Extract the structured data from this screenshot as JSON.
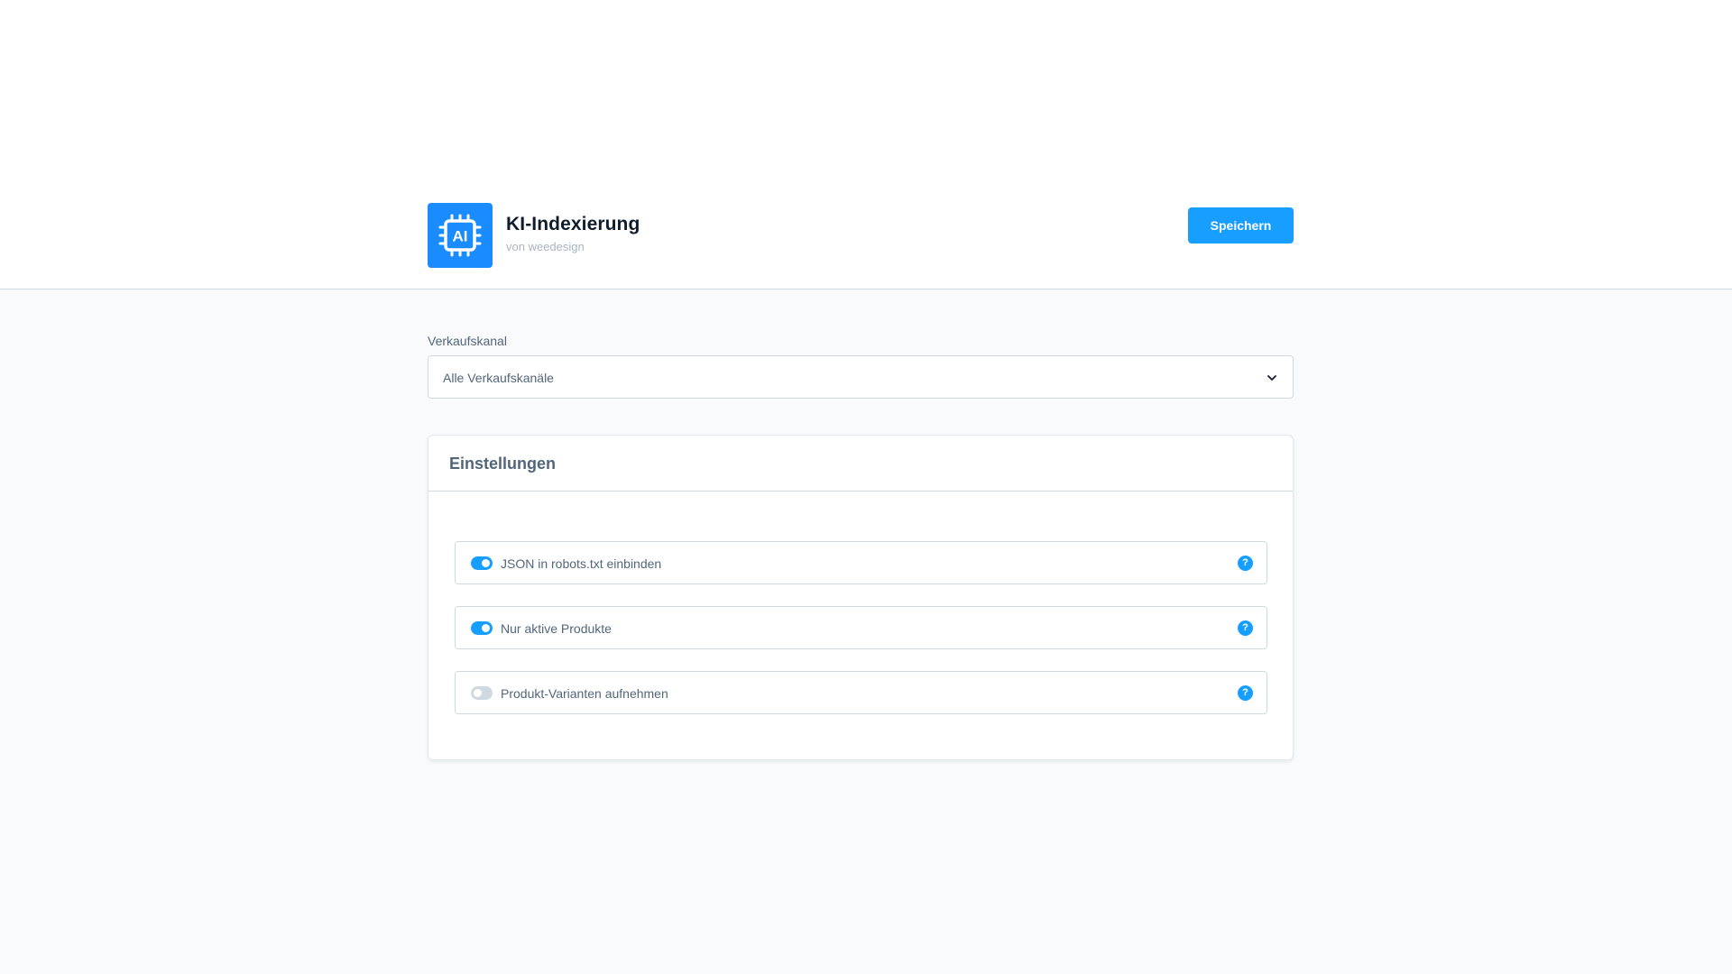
{
  "app": {
    "title": "KI-Indexierung",
    "subtitle": "von weedesign",
    "logo_icon": "ai-chip-icon",
    "logo_text": "AI",
    "accent": "#189eff"
  },
  "toolbar": {
    "save_label": "Speichern"
  },
  "sales_channel": {
    "label": "Verkaufskanal",
    "value": "Alle Verkaufskanäle",
    "icon": "chevron-down-icon"
  },
  "settings": {
    "title": "Einstellungen",
    "options": [
      {
        "label": "JSON in robots.txt einbinden",
        "enabled": true,
        "help": "?"
      },
      {
        "label": "Nur aktive Produkte",
        "enabled": true,
        "help": "?"
      },
      {
        "label": "Produkt-Varianten aufnehmen",
        "enabled": false,
        "help": "?"
      }
    ]
  }
}
